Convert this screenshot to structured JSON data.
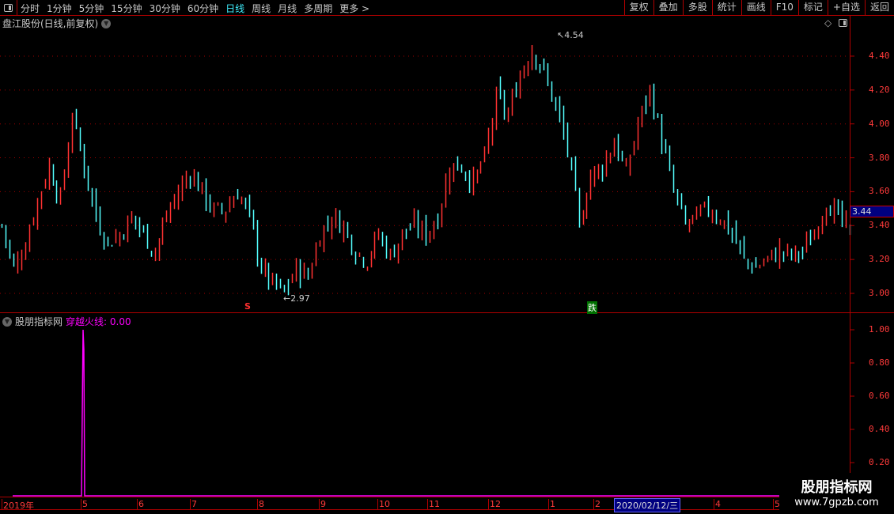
{
  "toolbar": {
    "periods": [
      "分时",
      "1分钟",
      "5分钟",
      "15分钟",
      "30分钟",
      "60分钟",
      "日线",
      "周线",
      "月线",
      "多周期",
      "更多 >"
    ],
    "active_period": "日线",
    "buttons": [
      "复权",
      "叠加",
      "多股",
      "统计",
      "画线",
      "F10",
      "标记",
      "+自选",
      "返回"
    ]
  },
  "main": {
    "title": "盘江股份(日线,前复权)",
    "price_ticks": [
      "4.40",
      "4.20",
      "4.00",
      "3.80",
      "3.60",
      "3.40",
      "3.20",
      "3.00"
    ],
    "current_price": "3.44",
    "high_label": "4.54",
    "low_label": "2.97",
    "signal_s": "S",
    "signal_die": "跌"
  },
  "indicator": {
    "name": "股朋指标网",
    "series_label": "穿越火线: 0.00",
    "ticks": [
      "1.00",
      "0.80",
      "0.60",
      "0.40",
      "0.20"
    ]
  },
  "xaxis": {
    "labels": [
      "2019年",
      "5",
      "6",
      "7",
      "8",
      "9",
      "10",
      "11",
      "12",
      "1",
      "2",
      "4",
      "5"
    ],
    "cursor_date": "2020/02/12/三"
  },
  "watermark": {
    "name": "股朋指标网",
    "url": "www.7gpzb.com"
  },
  "colors": {
    "up": "#ff3232",
    "down": "#54ffff",
    "grid": "#b00000",
    "indicator": "#ff00ff",
    "axis_text": "#ff3a3a"
  },
  "chart_data": {
    "type": "candlestick",
    "note_range": [
      2.97,
      4.54
    ],
    "closes": [
      3.4,
      3.15,
      3.3,
      3.55,
      3.75,
      3.55,
      4.05,
      3.75,
      3.45,
      3.3,
      3.35,
      3.45,
      3.35,
      3.25,
      3.45,
      3.6,
      3.72,
      3.6,
      3.48,
      3.5,
      3.6,
      3.45,
      3.15,
      3.05,
      3.0,
      3.15,
      3.1,
      3.35,
      3.45,
      3.4,
      3.25,
      3.2,
      3.35,
      3.22,
      3.35,
      3.4,
      3.35,
      3.45,
      3.75,
      3.75,
      3.65,
      3.8,
      4.15,
      4.05,
      4.3,
      4.45,
      4.3,
      4.1,
      3.85,
      3.4,
      3.7,
      3.75,
      3.9,
      3.7,
      4.0,
      4.2,
      3.9,
      3.6,
      3.4,
      3.45,
      3.5,
      3.45,
      3.35,
      3.2,
      3.15,
      3.2,
      3.25,
      3.22,
      3.25,
      3.35,
      3.55,
      3.45,
      3.35
    ],
    "indicator_spike": {
      "month_label": "5",
      "value": 1.0
    }
  }
}
